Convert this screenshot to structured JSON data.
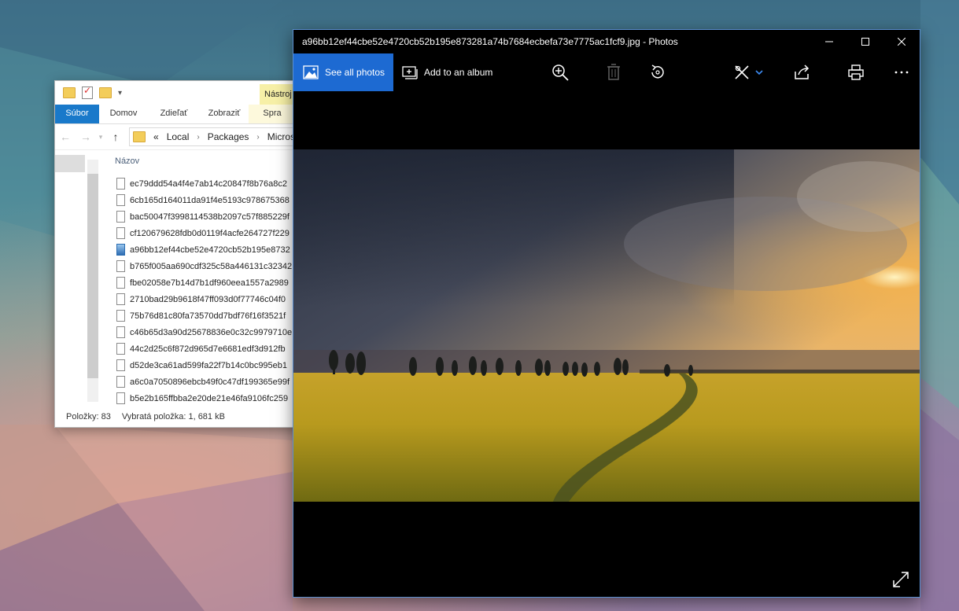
{
  "explorer": {
    "ribbon_tabs": {
      "file": "Súbor",
      "home": "Domov",
      "share": "Zdieľať",
      "view": "Zobraziť",
      "manage": "Spra"
    },
    "tools_tab": "Nástroj",
    "address": {
      "overflow": "«",
      "crumbs": [
        "Local",
        "Packages",
        "Micros"
      ]
    },
    "column_name": "Názov",
    "files": [
      "ec79ddd54a4f4e7ab14c20847f8b76a8c2",
      "6cb165d164011da91f4e5193c978675368",
      "bac50047f3998114538b2097c57f885229f",
      "cf120679628fdb0d0119f4acfe264727f229",
      "a96bb12ef44cbe52e4720cb52b195e8732",
      "b765f005aa690cdf325c58a446131c32342",
      "fbe02058e7b14d7b1df960eea1557a2989",
      "2710bad29b9618f47ff093d0f77746c04f0",
      "75b76d81c80fa73570dd7bdf76f16f3521f",
      "c46b65d3a90d25678836e0c32c9979710e",
      "44c2d25c6f872d965d7e6681edf3d912fb",
      "d52de3ca61ad599fa22f7b14c0bc995eb1",
      "a6c0a7050896ebcb49f0c47df199365e99f",
      "b5e2b165ffbba2e20de21e46fa9106fc259"
    ],
    "selected_file_index": 4,
    "status": {
      "items": "Položky: 83",
      "selected": "Vybratá položka: 1, 681 kB"
    }
  },
  "photos": {
    "title": "a96bb12ef44cbe52e4720cb52b195e873281a74b7684ecbefa73e7775ac1fcf9.jpg - Photos",
    "see_all_label": "See all photos",
    "add_album_label": "Add to an album",
    "icons": [
      "zoom-in-icon",
      "delete-icon",
      "rotate-icon",
      "edit-icon",
      "share-icon",
      "print-icon",
      "more-icon",
      "expand-icon"
    ],
    "accent": "#1d6ad2"
  }
}
